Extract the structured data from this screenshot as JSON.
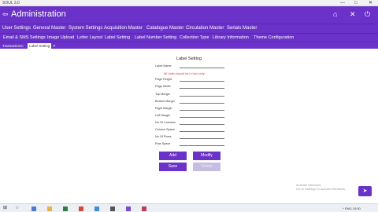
{
  "window": {
    "title": "SOUL 3.0",
    "minimize_glyph": "—",
    "maximize_glyph": "□",
    "close_glyph": "✕"
  },
  "appbar": {
    "back_glyph": "⇦",
    "title": "Administration",
    "home_glyph": "⌂",
    "close_glyph": "✕",
    "power_glyph": "⏻"
  },
  "menu": [
    "User Settings",
    "General Master",
    "System Settings",
    "Acquisition Master",
    "Catalogue Master",
    "Circulation Master",
    "Serials Master"
  ],
  "submenu": [
    "Email & SMS Settings",
    "Image Upload",
    "Letter Layout",
    "Label Setting",
    "Label Number Setting",
    "Collection Type",
    "Library Information",
    "Theme Configuration"
  ],
  "breadcrumb": {
    "root": "Transactions",
    "separator": "›",
    "current": "Label Setting",
    "close_glyph": "✕"
  },
  "form": {
    "title": "Label Setting",
    "note": "All Units should be in Inch only",
    "fields": [
      "Label Name",
      "Page Height",
      "Page Width",
      "Top Margin",
      "Bottom Margin",
      "Right Margin",
      "Left Margin",
      "No Of Columns",
      "Column Space",
      "No Of Rows",
      "Row Space"
    ],
    "buttons": {
      "add": "Add",
      "modify": "Modify",
      "save": "Save",
      "delete": "Delete"
    }
  },
  "watermark": {
    "line1": "Activate Windows",
    "line2": "Go to Settings to activate Windows."
  },
  "fab_glyph": "➤",
  "taskbar": {
    "start_glyph": "⊞",
    "search_glyph": "○",
    "system_text": "^  ENG  10:00"
  }
}
